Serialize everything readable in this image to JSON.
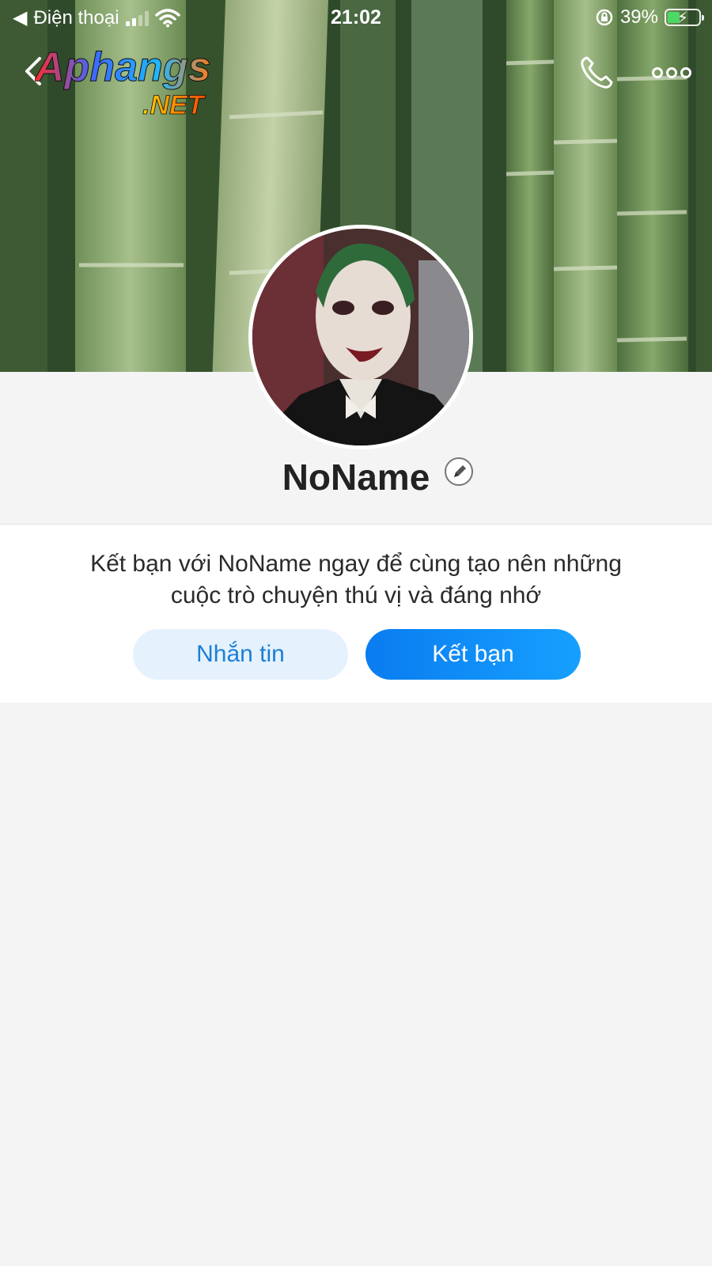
{
  "status_bar": {
    "back_app": "Điện thoại",
    "time": "21:02",
    "battery_percent": "39%",
    "battery_level": 0.39,
    "icons": [
      "back-triangle-icon",
      "signal-icon",
      "wifi-icon",
      "rotation-lock-icon",
      "battery-charging-icon"
    ]
  },
  "header": {
    "back_icon": "chevron-left-icon",
    "call_icon": "phone-icon",
    "more_icon": "more-dots-icon"
  },
  "watermark": {
    "brand": "Aphangs",
    "suffix": ".NET"
  },
  "profile": {
    "name": "NoName",
    "edit_icon": "pencil-icon"
  },
  "friend_card": {
    "invite_line1": "Kết bạn với NoName ngay để cùng tạo nên những",
    "invite_line2": "cuộc trò chuyện thú vị và đáng nhớ",
    "message_button": "Nhắn tin",
    "add_friend_button": "Kết bạn"
  },
  "colors": {
    "accent": "#0a7cf0",
    "secondary_button_bg": "#e5f1fc",
    "secondary_button_text": "#1b7fd6",
    "page_bg": "#f4f4f5",
    "battery_green": "#4cd964"
  }
}
